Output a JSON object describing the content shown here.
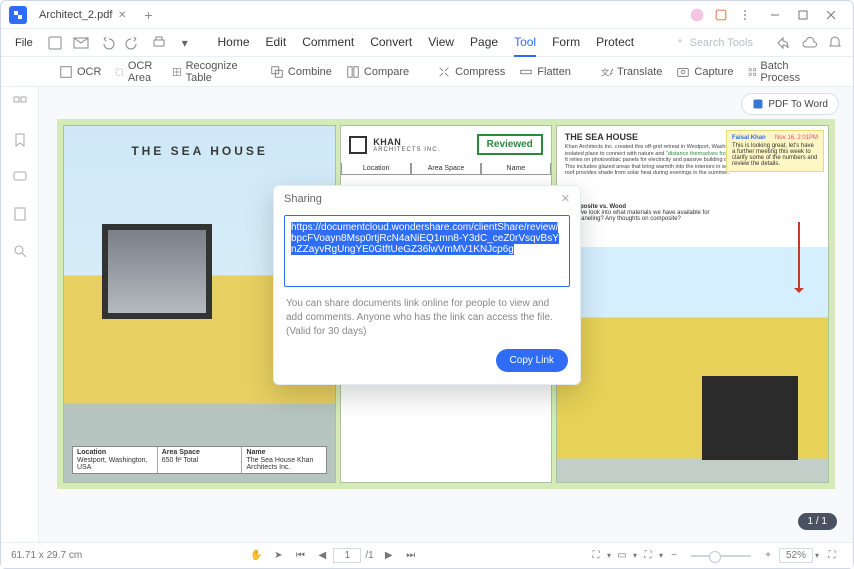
{
  "tab": {
    "title": "Architect_2.pdf"
  },
  "file_menu": {
    "file": "File"
  },
  "menu_tabs": [
    "Home",
    "Edit",
    "Comment",
    "Convert",
    "View",
    "Page",
    "Tool",
    "Form",
    "Protect"
  ],
  "active_tab": "Tool",
  "search_tools_placeholder": "Search Tools",
  "ribbon": {
    "ocr": "OCR",
    "ocr_area": "OCR Area",
    "recognize_table": "Recognize Table",
    "combine": "Combine",
    "compare": "Compare",
    "compress": "Compress",
    "flatten": "Flatten",
    "translate": "Translate",
    "capture": "Capture",
    "batch": "Batch Process"
  },
  "pdf_to_word": "PDF To Word",
  "modal": {
    "title": "Sharing",
    "link": "https://documentcloud.wondershare.com/clientShare/review/bpcFVoayn8Msp0rtjRcN4aNiEQ1mn8-Y3dC_ceZ0rVsqvBsYnZZayvRgUngYE0GtftUeGZ36lwVmMV1KNJcp6g",
    "description": "You can share documents link online for people to view and add comments. Anyone who has the link can access the file. (Valid for 30 days)",
    "copy_label": "Copy Link"
  },
  "document": {
    "main_title": "THE SEA HOUSE",
    "table": {
      "h1": "Location",
      "v1": "Westport,\nWashington, USA",
      "h2": "Area Space",
      "v2": "650 ft²\nTotal",
      "h3": "Name",
      "v3": "The Sea House\nKhan Architects Inc."
    },
    "khan_name": "KHAN",
    "khan_sub": "ARCHITECTS INC.",
    "reviewed": "Reviewed",
    "c2_tabs": [
      "Location",
      "Area Space",
      "Name"
    ],
    "c3_title": "THE SEA HOUSE",
    "c3_desc_pre": "Khan Architects Inc. created this off-grid retreat in Westport, Washington for a family looking for an isolated place to connect with nature and ",
    "c3_desc_hl": "\"distance themselves from social stresses\".",
    "c3_desc_post": "It relies on photovoltaic panels for electricity and passive building designs to control the temperature. This includes glazed areas that bring warmth into the interiors in winter, while an extended west-facing roof provides shade from solar heat during evenings in the summer.",
    "note": {
      "author": "Faisal Khan",
      "time": "Nov 16, 2:01PM",
      "body": "This is looking great, let's have a further meeting this week to clarify some of the numbers and review the details."
    },
    "annotation": {
      "title": "Composite vs. Wood",
      "body": "Can we look into what materials we have available for this paneling? Any thoughts on composite?"
    }
  },
  "page_badge": "1 / 1",
  "status": {
    "dims": "61.71 x 29.7 cm",
    "page_field": "1",
    "page_total": "/1",
    "zoom": "52%"
  }
}
